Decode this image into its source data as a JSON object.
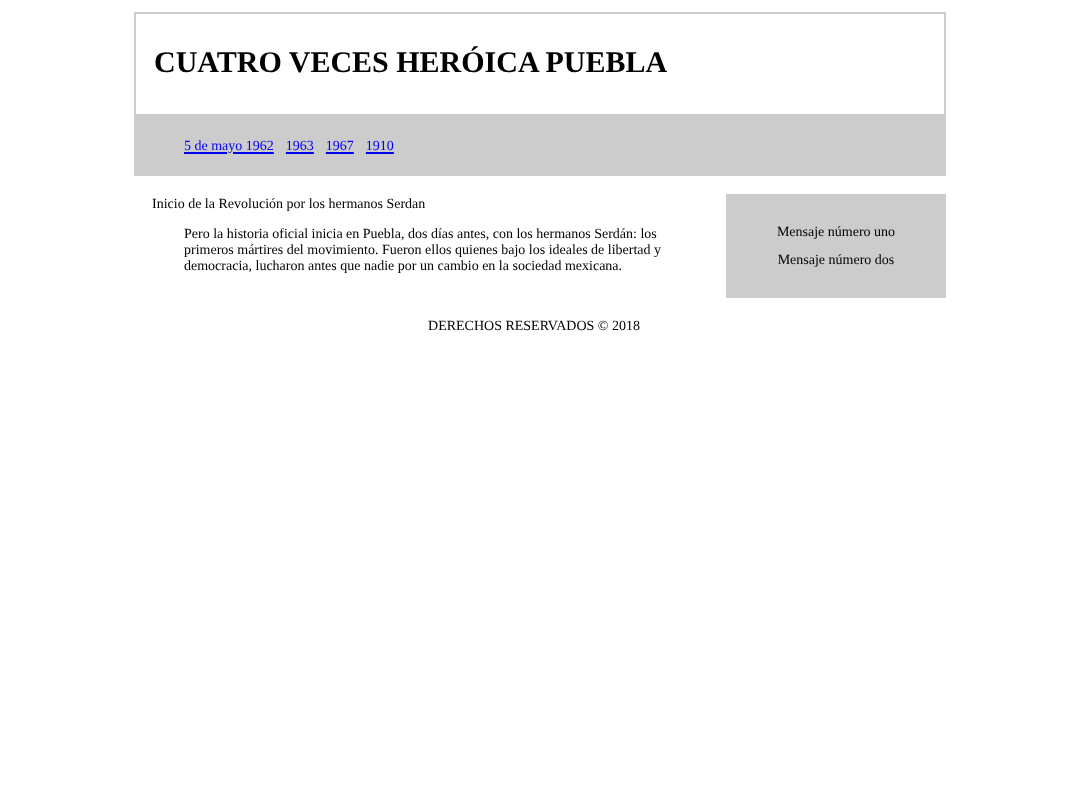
{
  "header": {
    "title": "CUATRO VECES HERÓICA PUEBLA"
  },
  "nav": {
    "links": [
      "5 de mayo 1962",
      "1963",
      "1967",
      "1910"
    ]
  },
  "article": {
    "heading": "Inicio de la Revolución por los hermanos Serdan",
    "paragraph": "Pero la historia oficial inicia en Puebla, dos días antes, con los hermanos Serdán: los primeros mártires del movimiento. Fueron ellos quienes bajo los ideales de libertad y democracia, lucharon antes que nadie por un cambio en la sociedad mexicana."
  },
  "aside": {
    "messages": [
      "Mensaje número uno",
      "Mensaje número dos"
    ]
  },
  "footer": {
    "text": "DERECHOS RESERVADOS © 2018"
  }
}
